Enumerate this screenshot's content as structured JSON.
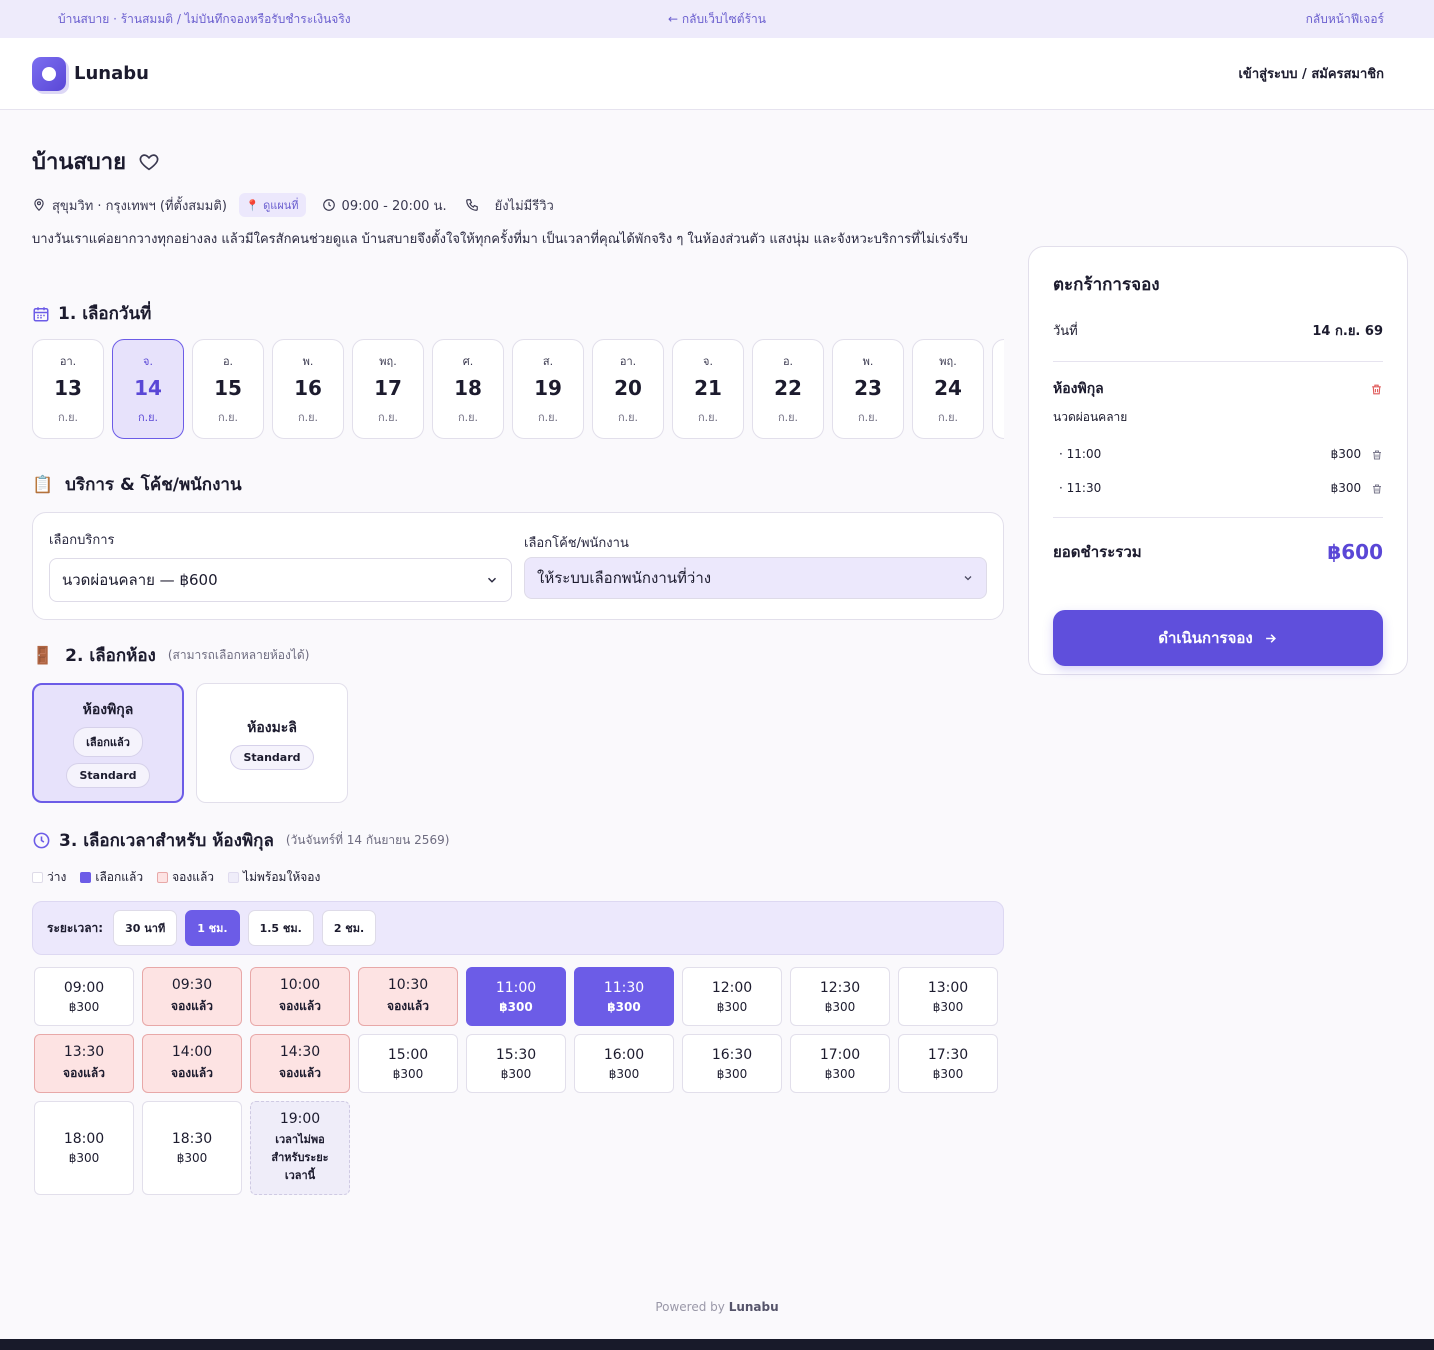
{
  "topbar": {
    "left": "บ้านสบาย · ร้านสมมติ / ไม่บันทึกจองหรือรับชำระเงินจริง",
    "center": "← กลับเว็บไซต์ร้าน",
    "right": "กลับหน้าฟีเจอร์"
  },
  "header": {
    "brand": "Lunabu",
    "login": "เข้าสู่ระบบ / สมัครสมาชิก"
  },
  "shop": {
    "name": "บ้านสบาย",
    "location": "สุขุมวิท · กรุงเทพฯ (ที่ตั้งสมมติ)",
    "map_label": "ดูแผนที่",
    "hours": "09:00 - 20:00 น.",
    "reviews": "ยังไม่มีรีวิว",
    "description": "บางวันเราแค่อยากวางทุกอย่างลง แล้วมีใครสักคนช่วยดูแล บ้านสบายจึงตั้งใจให้ทุกครั้งที่มา เป็นเวลาที่คุณได้พักจริง ๆ ในห้องส่วนตัว แสงนุ่ม และจังหวะบริการที่ไม่เร่งรีบ"
  },
  "step1": {
    "title": "1. เลือกวันที่",
    "days": [
      {
        "dow": "อา.",
        "date": "13",
        "month": "ก.ย."
      },
      {
        "dow": "จ.",
        "date": "14",
        "month": "ก.ย."
      },
      {
        "dow": "อ.",
        "date": "15",
        "month": "ก.ย."
      },
      {
        "dow": "พ.",
        "date": "16",
        "month": "ก.ย."
      },
      {
        "dow": "พฤ.",
        "date": "17",
        "month": "ก.ย."
      },
      {
        "dow": "ศ.",
        "date": "18",
        "month": "ก.ย."
      },
      {
        "dow": "ส.",
        "date": "19",
        "month": "ก.ย."
      },
      {
        "dow": "อา.",
        "date": "20",
        "month": "ก.ย."
      },
      {
        "dow": "จ.",
        "date": "21",
        "month": "ก.ย."
      },
      {
        "dow": "อ.",
        "date": "22",
        "month": "ก.ย."
      },
      {
        "dow": "พ.",
        "date": "23",
        "month": "ก.ย."
      },
      {
        "dow": "พฤ.",
        "date": "24",
        "month": "ก.ย."
      },
      {
        "dow": "",
        "date": "",
        "month": ""
      }
    ],
    "selected_index": 1
  },
  "service": {
    "title": "บริการ & โค้ช/พนักงาน",
    "service_label": "เลือกบริการ",
    "service_value": "นวดผ่อนคลาย — ฿600",
    "staff_label": "เลือกโค้ช/พนักงาน",
    "staff_value": "ให้ระบบเลือกพนักงานที่ว่าง"
  },
  "step2": {
    "title": "2. เลือกห้อง",
    "subtitle": "(สามารถเลือกหลายห้องได้)",
    "rooms": [
      {
        "name": "ห้องพิกุล",
        "selected_tag": "เลือกแล้ว",
        "type": "Standard"
      },
      {
        "name": "ห้องมะลิ",
        "type": "Standard"
      }
    ]
  },
  "step3": {
    "title": "3. เลือกเวลาสำหรับ ห้องพิกุล",
    "subtitle": "(วันจันทร์ที่ 14 กันยายน 2569)",
    "legend": {
      "free": "ว่าง",
      "selected": "เลือกแล้ว",
      "booked": "จองแล้ว",
      "unavailable": "ไม่พร้อมให้จอง"
    },
    "duration_label": "ระยะเวลา:",
    "durations": [
      "30 นาที",
      "1 ชม.",
      "1.5 ชม.",
      "2 ชม."
    ],
    "duration_selected": 1,
    "slots": [
      {
        "time": "09:00",
        "label": "฿300",
        "state": "free"
      },
      {
        "time": "09:30",
        "label": "จองแล้ว",
        "state": "booked"
      },
      {
        "time": "10:00",
        "label": "จองแล้ว",
        "state": "booked"
      },
      {
        "time": "10:30",
        "label": "จองแล้ว",
        "state": "booked"
      },
      {
        "time": "11:00",
        "label": "฿300",
        "state": "selected"
      },
      {
        "time": "11:30",
        "label": "฿300",
        "state": "selected"
      },
      {
        "time": "12:00",
        "label": "฿300",
        "state": "free"
      },
      {
        "time": "12:30",
        "label": "฿300",
        "state": "free"
      },
      {
        "time": "13:00",
        "label": "฿300",
        "state": "free"
      },
      {
        "time": "13:30",
        "label": "จองแล้ว",
        "state": "booked"
      },
      {
        "time": "14:00",
        "label": "จองแล้ว",
        "state": "booked"
      },
      {
        "time": "14:30",
        "label": "จองแล้ว",
        "state": "booked"
      },
      {
        "time": "15:00",
        "label": "฿300",
        "state": "free"
      },
      {
        "time": "15:30",
        "label": "฿300",
        "state": "free"
      },
      {
        "time": "16:00",
        "label": "฿300",
        "state": "free"
      },
      {
        "time": "16:30",
        "label": "฿300",
        "state": "free"
      },
      {
        "time": "17:00",
        "label": "฿300",
        "state": "free"
      },
      {
        "time": "17:30",
        "label": "฿300",
        "state": "free"
      },
      {
        "time": "18:00",
        "label": "฿300",
        "state": "free-tall"
      },
      {
        "time": "18:30",
        "label": "฿300",
        "state": "free-tall"
      },
      {
        "time": "19:00",
        "label": "เวลาไม่พอสำหรับระยะเวลานี้",
        "state": "unavailable"
      }
    ]
  },
  "cart": {
    "title": "ตะกร้าการจอง",
    "date_label": "วันที่",
    "date_value": "14 ก.ย. 69",
    "room": "ห้องพิกุล",
    "service": "นวดผ่อนคลาย",
    "items": [
      {
        "time": "· 11:00",
        "price": "฿300"
      },
      {
        "time": "· 11:30",
        "price": "฿300"
      }
    ],
    "total_label": "ยอดชำระรวม",
    "total_value": "฿600",
    "cta": "ดำเนินการจอง"
  },
  "footer": {
    "prefix": "Powered by",
    "brand": "Lunabu"
  },
  "colors": {
    "accent": "#6c5ce7",
    "booked_bg": "#fde3e3",
    "selected_bg": "#e7e2fb",
    "footer_bar": "#181a2a"
  }
}
